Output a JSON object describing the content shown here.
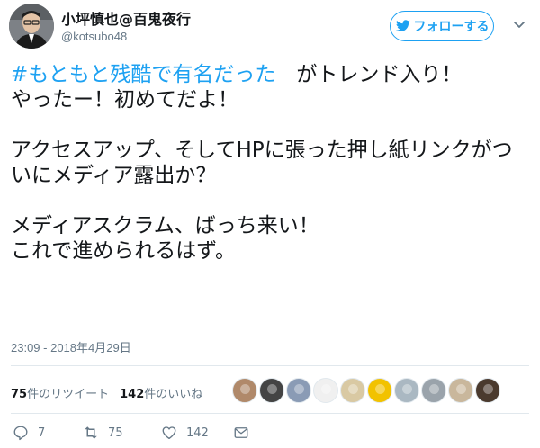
{
  "user": {
    "display_name": "小坪慎也@百鬼夜行",
    "handle": "@kotsubo48"
  },
  "follow_button": {
    "label": "フォローする"
  },
  "tweet": {
    "hashtag": "#もともと残酷で有名だった",
    "text_after_hashtag": "　がトレンド入り！\nやったー！初めてだよ！\n\nアクセスアップ、そしてHPに張った押し紙リンクがついにメディア露出か？\n\nメディアスクラム、ばっち来い！\nこれで進められるはず。",
    "timestamp": "23:09 - 2018年4月29日"
  },
  "stats": {
    "retweets_count": "75",
    "retweets_label": "件のリツイート",
    "likes_count": "142",
    "likes_label": "件のいいね"
  },
  "likers": [
    {
      "icon": "liker-avatar-1",
      "color": "#b0896a"
    },
    {
      "icon": "liker-avatar-2",
      "color": "#444444"
    },
    {
      "icon": "liker-avatar-3",
      "color": "#8a9bb5"
    },
    {
      "icon": "liker-avatar-4",
      "color": "#f0f0f0"
    },
    {
      "icon": "liker-avatar-5",
      "color": "#d9c9a3"
    },
    {
      "icon": "liker-avatar-6",
      "color": "#f2c200"
    },
    {
      "icon": "liker-avatar-7",
      "color": "#aab8c2"
    },
    {
      "icon": "liker-avatar-8",
      "color": "#9aa3ab"
    },
    {
      "icon": "liker-avatar-9",
      "color": "#c9b79c"
    },
    {
      "icon": "liker-avatar-10",
      "color": "#4a3a2e"
    }
  ],
  "actions": {
    "reply_count": "7",
    "retweet_count": "75",
    "like_count": "142"
  },
  "colors": {
    "accent": "#1da1f2",
    "muted": "#657786",
    "text": "#14171a"
  }
}
